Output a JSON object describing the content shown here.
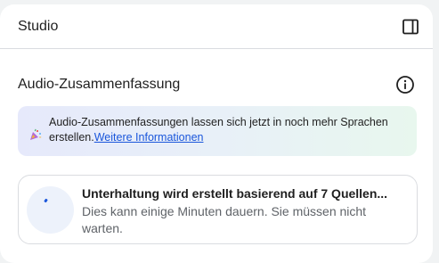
{
  "header": {
    "title": "Studio",
    "toggle_icon": "side-panel-icon"
  },
  "audio_overview": {
    "title": "Audio-Zusammenfassung",
    "info_icon": "info-icon",
    "banner": {
      "icon": "party-popper-icon",
      "text": "Audio-Zusammenfassungen lassen sich jetzt in noch mehr Sprachen erstellen.",
      "link_label": "Weitere Informationen"
    },
    "generation_card": {
      "icon": "loading-spinner-icon",
      "title": "Unterhaltung wird erstellt basierend auf 7 Quellen...",
      "subtitle": "Dies kann einige Minuten dauern. Sie müssen nicht warten."
    }
  },
  "colors": {
    "link": "#1a56db",
    "text_primary": "#1f1f1f",
    "text_secondary": "#5f6368",
    "border": "#dadce0"
  }
}
